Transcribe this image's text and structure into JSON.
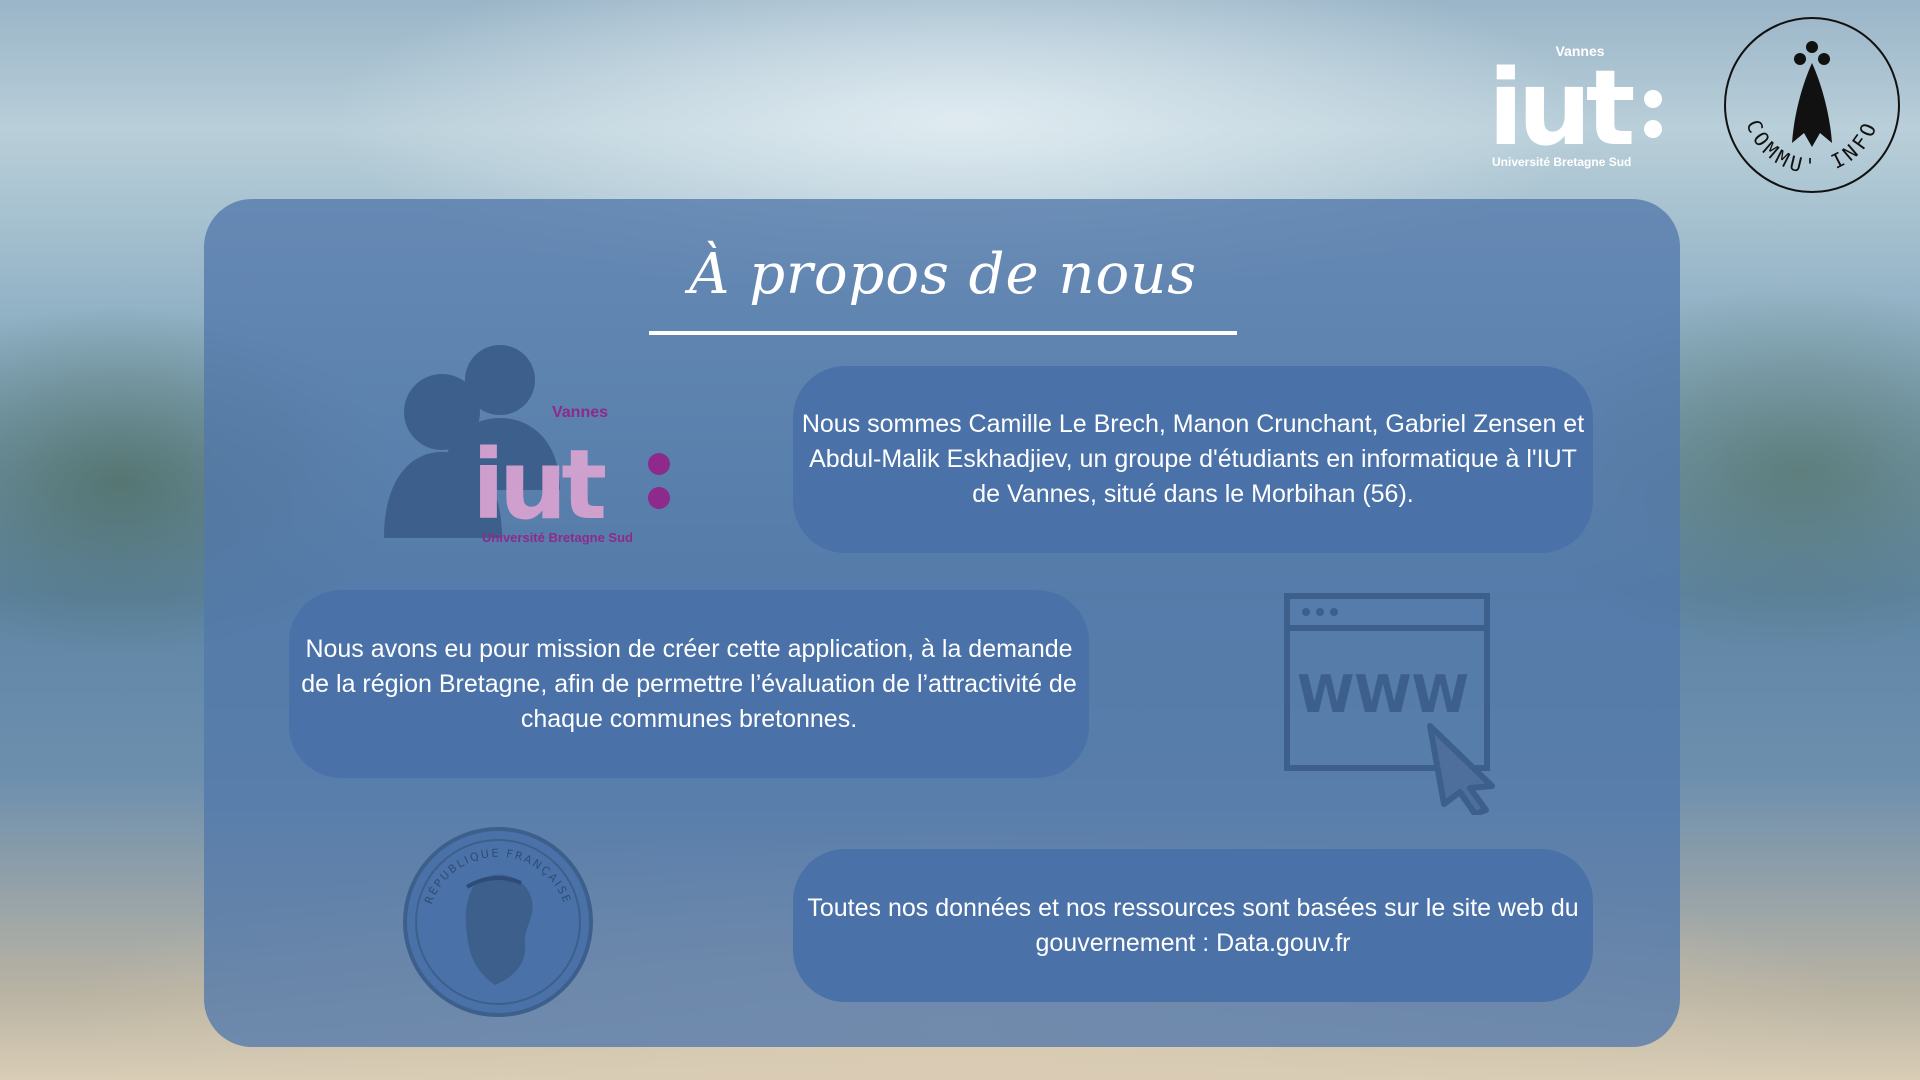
{
  "header": {
    "iut_logo": {
      "city": "Vannes",
      "wordmark": "iut",
      "university": "Université Bretagne Sud"
    },
    "commu_logo": {
      "text": "COMMU' INFO",
      "icon": "ermine-icon"
    }
  },
  "main": {
    "title": "À propos de nous",
    "intro": "Nous sommes Camille Le Brech, Manon Crunchant, Gabriel Zensen et Abdul-Malik Eskhadjiev, un groupe d'étudiants en informatique à l'IUT de Vannes, situé dans le Morbihan (56).",
    "mission": "Nous avons eu pour mission de créer cette application, à la demande de la région Bretagne, afin de permettre l’évaluation de l’attractivité de chaque communes bretonnes.",
    "sources": "Toutes nos données et nos ressources sont basées sur le site web du gouvernement : Data.gouv.fr",
    "people_logo": {
      "city": "Vannes",
      "wordmark": "iut",
      "university": "Université Bretagne Sud"
    },
    "www_icon": {
      "text": "WWW"
    },
    "coin": {
      "text": "RÉPUBLIQUE FRANÇAISE"
    }
  },
  "colors": {
    "panel": "#5278aa",
    "bubble": "#4a72a8",
    "illustration": "#3d5f8c",
    "iut_pink": "#d6a2d0",
    "iut_purple": "#8d2a8c"
  }
}
